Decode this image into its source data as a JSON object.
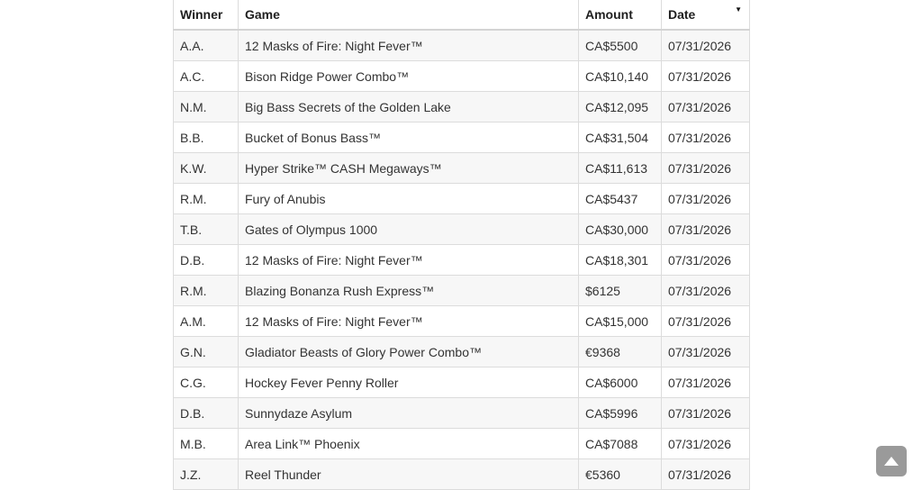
{
  "table": {
    "headers": {
      "winner": "Winner",
      "game": "Game",
      "amount": "Amount",
      "date": "Date"
    },
    "sort_icon": "sort-descending-icon",
    "rows": [
      {
        "winner": "A.A.",
        "game": "12 Masks of Fire: Night Fever™",
        "amount": "CA$5500",
        "date": "07/31/2026"
      },
      {
        "winner": "A.C.",
        "game": "Bison Ridge Power Combo™",
        "amount": "CA$10,140",
        "date": "07/31/2026"
      },
      {
        "winner": "N.M.",
        "game": "Big Bass Secrets of the Golden Lake",
        "amount": "CA$12,095",
        "date": "07/31/2026"
      },
      {
        "winner": "B.B.",
        "game": "Bucket of Bonus Bass™",
        "amount": "CA$31,504",
        "date": "07/31/2026"
      },
      {
        "winner": "K.W.",
        "game": "Hyper Strike™ CASH Megaways™",
        "amount": "CA$11,613",
        "date": "07/31/2026"
      },
      {
        "winner": "R.M.",
        "game": "Fury of Anubis",
        "amount": "CA$5437",
        "date": "07/31/2026"
      },
      {
        "winner": "T.B.",
        "game": "Gates of Olympus 1000",
        "amount": "CA$30,000",
        "date": "07/31/2026"
      },
      {
        "winner": "D.B.",
        "game": "12 Masks of Fire: Night Fever™",
        "amount": "CA$18,301",
        "date": "07/31/2026"
      },
      {
        "winner": "R.M.",
        "game": "Blazing Bonanza Rush Express™",
        "amount": "$6125",
        "date": "07/31/2026"
      },
      {
        "winner": "A.M.",
        "game": "12 Masks of Fire: Night Fever™",
        "amount": "CA$15,000",
        "date": "07/31/2026"
      },
      {
        "winner": "G.N.",
        "game": "Gladiator Beasts of Glory Power Combo™",
        "amount": "€9368",
        "date": "07/31/2026"
      },
      {
        "winner": "C.G.",
        "game": "Hockey Fever Penny Roller",
        "amount": "CA$6000",
        "date": "07/31/2026"
      },
      {
        "winner": "D.B.",
        "game": "Sunnydaze Asylum",
        "amount": "CA$5996",
        "date": "07/31/2026"
      },
      {
        "winner": "M.B.",
        "game": "Area Link™ Phoenix",
        "amount": "CA$7088",
        "date": "07/31/2026"
      },
      {
        "winner": "J.Z.",
        "game": "Reel Thunder",
        "amount": "€5360",
        "date": "07/31/2026"
      }
    ]
  },
  "scroll_top_button": {
    "icon": "arrow-up-icon",
    "color": "#9a9a9a"
  }
}
